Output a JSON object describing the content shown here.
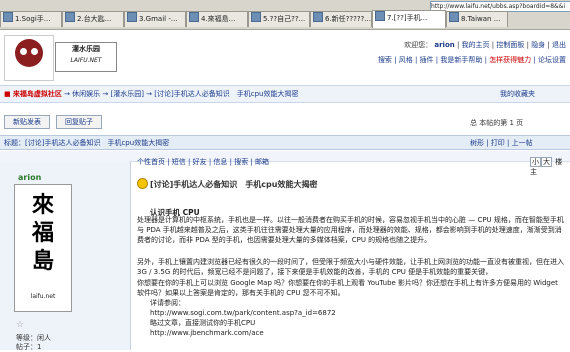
{
  "browser": {
    "address": "http://www.laifu.net/ubbs.asp?boardid=8&&i",
    "tabs": [
      {
        "label": "1.Sogi手...",
        "active": false
      },
      {
        "label": "2.台大匙...",
        "active": false
      },
      {
        "label": "3.Gmail -...",
        "active": false
      },
      {
        "label": "4.來福島...",
        "active": false
      },
      {
        "label": "5.??自己??...",
        "active": false
      },
      {
        "label": "6.新任?????...",
        "active": false
      },
      {
        "label": "7.[??]手机...",
        "active": true
      },
      {
        "label": "8.Taiwan ...",
        "active": false
      }
    ]
  },
  "header": {
    "logo_text": "灌水乐园",
    "logo_sub": "LAIFU.NET",
    "welcome": "欢迎您：",
    "username": "arion",
    "links_top": [
      "我的主页",
      "控制面板",
      "隐身",
      "退出"
    ],
    "links_bottom": [
      "搜索",
      "风格",
      "插件",
      "我是新手帮助",
      "怎样获得魅力",
      "论坛设置"
    ]
  },
  "breadcrumb": {
    "site": "来福岛虚拟社区",
    "path": " → 休闲娱乐 → [灌水乐园] → [讨论]手机达人必备知识　手机cpu效能大揭密",
    "favorites": "我的收藏夹"
  },
  "actions": {
    "new_topic": "新贴发表",
    "reply": "回复贴子",
    "page_stats": "总 本帖的第 1 页"
  },
  "thread": {
    "title": "标题：[讨论]手机达人必备知识　手机cpu效能大揭密",
    "nav": [
      "树形",
      "打印",
      "上一帖"
    ]
  },
  "post": {
    "author": "arion",
    "avatar_chars": [
      "來",
      "福",
      "島"
    ],
    "avatar_caption": "laifu.net",
    "star": "☆",
    "rank_label": "等级：闲人",
    "post_label": "帖子：1",
    "tools": "个性首页 | 短信 | 好友 | 信息 | 搜索 | 邮箱",
    "font_buttons": [
      "小",
      "大"
    ],
    "quote_label": "楼主",
    "title": "[讨论]手机达人必备知识　手机cpu效能大揭密",
    "section_title": "认识手机 CPU",
    "paragraphs": [
      "处理器是计算机的中枢系统，手机也是一样。以往一般消费者在购买手机的时候，容易忽视手机当中的心脏 — CPU 规格，而在智能型手机与 PDA 手机越来越普及之后，这类手机往往需要处理大量的应用程序，而处理器的效能、规格，都会影响到手机的处理速度，渐渐受到消费者的讨论，而非 PDA 型的手机，也因需要处理大量的多媒体档案，CPU 的规格也随之提升。",
      "另外，手机上镶置内建浏览器已经有很久的一段时间了，但受限于频宽大小与硬件效能，让手机上网浏览的功能一直没有被重视，但在进入 3G / 3.5G 的时代后，频宽已经不是问题了，接下来便是手机效能的改善，手机的 CPU 便是手机效能的重要关键，",
      "你想要在你的手机上可以浏览 Google Map 吗？你想要在你的手机上观看 YouTube 影片吗？你还想在手机上有许多方便易用的 Widget 软件吗？如果以上答案是肯定的，那有关手机的 CPU 您不可不知。",
      "详请参阅：",
      "http://www.sogi.com.tw/park/content.asp?a_id=6872",
      "略过文章，直接测试你的手机CPU",
      "http://www.jbenchmark.com/ace"
    ]
  },
  "colors": {
    "link": "#1a3a8a",
    "accent_red": "#cc0000",
    "author_green": "#2a7a2a",
    "header_bg": "#eef3fa"
  }
}
